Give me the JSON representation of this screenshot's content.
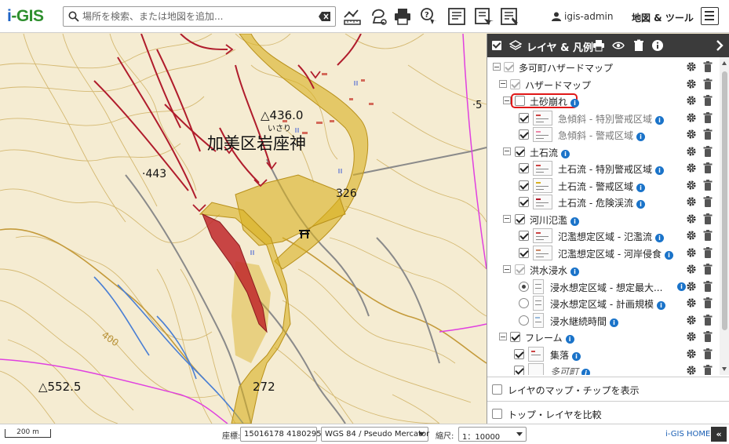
{
  "app": {
    "logo_i": "i",
    "logo_rest": "-GIS",
    "brand_color": "#2e8f2e"
  },
  "search": {
    "placeholder": "場所を検索、または地図を追加..."
  },
  "header": {
    "tool_icons": [
      "measure-icon",
      "draw-icon",
      "print-icon",
      "query-icon",
      "list-icon",
      "edit-icon",
      "report-icon"
    ],
    "user_name": "igis-admin",
    "map_tools_label": "地図 & ツール"
  },
  "map": {
    "labels": {
      "peak_436": "△436.0",
      "peak_436_reading": "いさり",
      "place_name": "加美区岩座神",
      "spot_443": "·443",
      "spot_326": "326",
      "peak_552": "△552.5",
      "spot_272": "272",
      "contour_400": "400",
      "edge_5": "·5"
    },
    "colors": {
      "hazard_yellow": "#d9b020",
      "hazard_red": "#c0282c",
      "stream_red": "#b01c2c",
      "boundary_magenta": "#e040e0",
      "river_blue": "#4a7fd4",
      "contour": "#c9a84a"
    }
  },
  "panel": {
    "title": "レイヤ & 凡例",
    "layers": [
      {
        "label": "多可町ハザードマップ",
        "checked": true,
        "dim": true,
        "info": false
      },
      {
        "label": "ハザードマップ",
        "checked": true,
        "dim": true,
        "info": false
      },
      {
        "label": "土砂崩れ",
        "checked": false,
        "dim": false,
        "info": true,
        "highlighted": true
      },
      {
        "label": "急傾斜 - 特別警戒区域",
        "checked": true,
        "grey": true,
        "info": true
      },
      {
        "label": "急傾斜 - 警戒区域",
        "checked": true,
        "grey": true,
        "info": true
      },
      {
        "label": "土石流",
        "checked": true,
        "info": true
      },
      {
        "label": "土石流 - 特別警戒区域",
        "checked": true,
        "info": true
      },
      {
        "label": "土石流 - 警戒区域",
        "checked": true,
        "info": true
      },
      {
        "label": "土石流 - 危険渓流",
        "checked": true,
        "info": true
      },
      {
        "label": "河川氾濫",
        "checked": true,
        "info": true
      },
      {
        "label": "氾濫想定区域 - 氾濫流",
        "checked": true,
        "info": true
      },
      {
        "label": "氾濫想定区域 - 河岸侵食",
        "checked": true,
        "info": true
      },
      {
        "label": "洪水浸水",
        "checked": true,
        "dim": true,
        "info": true
      },
      {
        "label": "浸水想定区域 - 想定最大...",
        "selected": true,
        "info": true
      },
      {
        "label": "浸水想定区域 - 計画規模",
        "selected": false,
        "info": true
      },
      {
        "label": "浸水継続時間",
        "selected": false,
        "info": true
      },
      {
        "label": "フレーム",
        "checked": true,
        "info": true
      },
      {
        "label": "集落",
        "checked": true,
        "info": true
      },
      {
        "label": "多可町",
        "checked": true,
        "italic": true,
        "info": true
      }
    ],
    "options": [
      {
        "label": "レイヤのマップ・チップを表示",
        "checked": false
      },
      {
        "label": "トップ・レイヤを比較",
        "checked": false
      }
    ]
  },
  "status": {
    "scale_label": "200 m",
    "coord_label": "座標:",
    "coord_value": "15016178 4180295",
    "crs_value": "WGS 84 / Pseudo Mercator",
    "scale_ratio_label": "縮尺:",
    "scale_ratio_value": "1：10000",
    "home_link": "i-GIS HOME",
    "collapse_glyph": "«"
  }
}
